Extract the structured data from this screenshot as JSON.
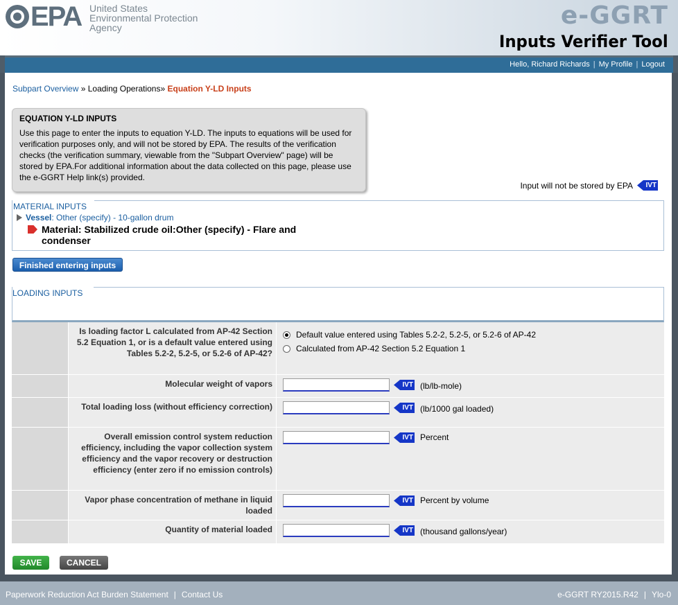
{
  "header": {
    "agency_line1": "United States",
    "agency_line2": "Environmental Protection",
    "agency_line3": "Agency",
    "epa_word": "EPA",
    "app_name": "e-GGRT",
    "app_subtitle": "Inputs Verifier Tool"
  },
  "user_nav": {
    "greeting": "Hello, Richard Richards",
    "my_profile": "My Profile",
    "logout": "Logout"
  },
  "breadcrumb": {
    "item1": "Subpart Overview",
    "sep1": " » ",
    "item2": "Loading Operations",
    "sep2": "» ",
    "current": "Equation Y-LD Inputs"
  },
  "info": {
    "title": "EQUATION Y-LD INPUTS",
    "text": "Use this page to enter the inputs to equation Y-LD. The inputs to equations will be used for verification purposes only, and will not be stored by EPA. The results of the verification checks (the verification summary, viewable from the \"Subpart Overview\" page) will be stored by EPA.For additional information about the data collected on this page, please use the e-GGRT Help link(s) provided."
  },
  "ivt_note": "Input will not be stored by EPA",
  "ivt_label": "IVT",
  "material_inputs": {
    "title": "MATERIAL INPUTS",
    "vessel_label": "Vessel",
    "vessel_value": ": Other (specify) - 10-gallon drum",
    "material_label": "Material",
    "material_value": ": Stabilized crude oil:Other (specify) - Flare and condenser"
  },
  "finished_button": "Finished entering inputs",
  "loading_inputs": {
    "title": "LOADING INPUTS",
    "rows": [
      {
        "label": "Is loading factor L calculated from AP-42 Section 5.2 Equation 1, or is a default value entered using Tables 5.2-2, 5.2-5, or 5.2-6 of AP-42?",
        "options": [
          "Default value entered using Tables 5.2-2, 5.2-5, or 5.2-6 of AP-42",
          "Calculated from AP-42 Section 5.2 Equation 1"
        ],
        "selected": 0
      },
      {
        "label": "Molecular weight of vapors",
        "value": "",
        "unit": "(lb/lb-mole)"
      },
      {
        "label": "Total loading loss (without efficiency correction)",
        "value": "",
        "unit": "(lb/1000 gal loaded)"
      },
      {
        "label": "Overall emission control system reduction efficiency, including the vapor collection system efficiency and the vapor recovery or destruction efficiency (enter zero if no emission controls)",
        "value": "",
        "unit": "Percent"
      },
      {
        "label": "Vapor phase concentration of methane in liquid loaded",
        "value": "",
        "unit": "Percent by volume"
      },
      {
        "label": "Quantity of material loaded",
        "value": "",
        "unit": "(thousand gallons/year)"
      }
    ]
  },
  "buttons": {
    "save": "SAVE",
    "cancel": "CANCEL"
  },
  "footer": {
    "paperwork": "Paperwork Reduction Act Burden Statement",
    "contact": "Contact Us",
    "version": "e-GGRT RY2015.R42",
    "code": "Ylo-0"
  },
  "colors": {
    "accent_blue": "#2f6d98",
    "link": "#1b5fa0",
    "current_crumb": "#c8401a",
    "ivt_tag": "#1536c7",
    "save_green": "#2a9a33"
  }
}
